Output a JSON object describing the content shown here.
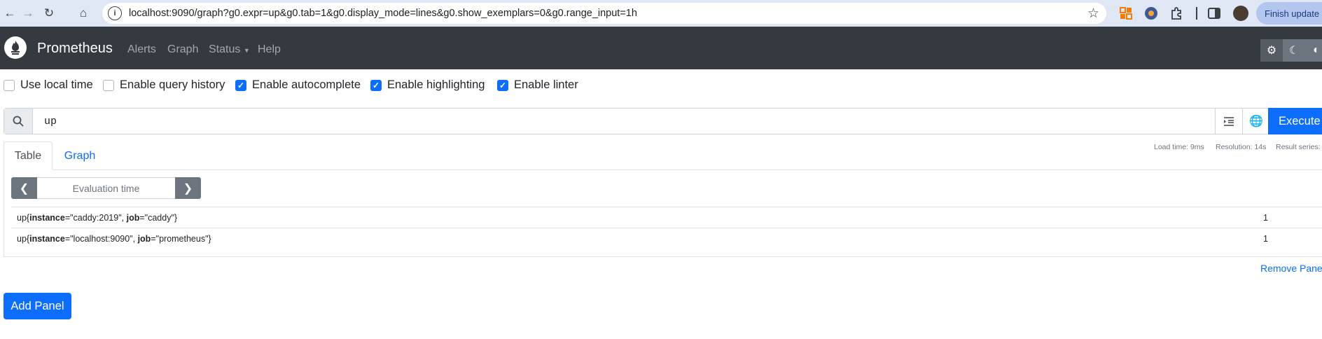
{
  "browser": {
    "url": "localhost:9090/graph?g0.expr=up&g0.tab=1&g0.display_mode=lines&g0.show_exemplars=0&g0.range_input=1h",
    "finish_update_label": "Finish update"
  },
  "navbar": {
    "brand": "Prometheus",
    "links": [
      "Alerts",
      "Graph",
      "Status",
      "Help"
    ]
  },
  "options": [
    {
      "label": "Use local time",
      "checked": false
    },
    {
      "label": "Enable query history",
      "checked": false
    },
    {
      "label": "Enable autocomplete",
      "checked": true
    },
    {
      "label": "Enable highlighting",
      "checked": true
    },
    {
      "label": "Enable linter",
      "checked": true
    }
  ],
  "query": {
    "expression": "up",
    "execute_label": "Execute"
  },
  "panel": {
    "tabs": [
      "Table",
      "Graph"
    ],
    "active_tab": "Table",
    "stats": {
      "load_time": "Load time: 9ms",
      "resolution": "Resolution: 14s",
      "result_series": "Result series:"
    },
    "evaluation_placeholder": "Evaluation time",
    "results": [
      {
        "metric": "up",
        "labels": [
          {
            "name": "instance",
            "value": "\"caddy:2019\""
          },
          {
            "name": "job",
            "value": "\"caddy\""
          }
        ],
        "value": "1"
      },
      {
        "metric": "up",
        "labels": [
          {
            "name": "instance",
            "value": "\"localhost:9090\""
          },
          {
            "name": "job",
            "value": "\"prometheus\""
          }
        ],
        "value": "1"
      }
    ],
    "remove_label": "Remove Panel"
  },
  "add_panel_label": "Add Panel",
  "colors": {
    "navbar_bg": "#343a40",
    "primary": "#0d6efd",
    "secondary": "#6c757d"
  }
}
